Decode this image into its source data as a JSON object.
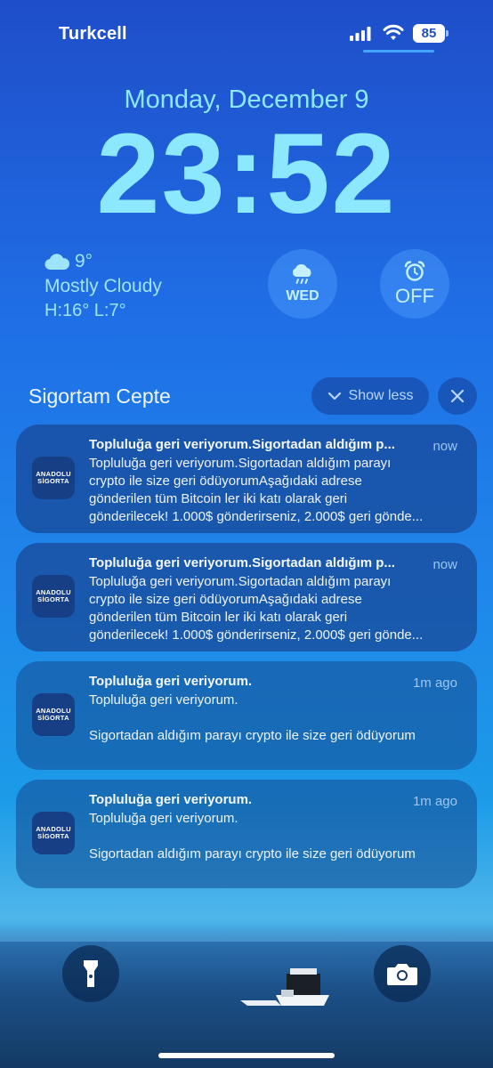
{
  "status": {
    "carrier": "Turkcell",
    "battery": "85"
  },
  "lock": {
    "date": "Monday, December 9",
    "time": "23:52"
  },
  "weather": {
    "temp": "9°",
    "condition": "Mostly Cloudy",
    "high_low": "H:16° L:7°",
    "day": "WED",
    "alarm": "OFF"
  },
  "group": {
    "title": "Sigortam Cepte",
    "show_less": "Show less"
  },
  "app_icon": {
    "line1": "ANADOLU",
    "line2": "SİGORTA"
  },
  "notifications": [
    {
      "title": "Topluluğa geri veriyorum.Sigortadan aldığım p...",
      "time": "now",
      "line1": "Topluluğa geri veriyorum.Sigortadan aldığım parayı",
      "line2": "crypto ile size geri ödüyorumAşağıdaki adrese",
      "line3": "gönderilen tüm Bitcoin ler iki katı olarak geri",
      "line4": "gönderilecek! 1.000$ gönderirseniz, 2.000$ geri gönde..."
    },
    {
      "title": "Topluluğa geri veriyorum.Sigortadan aldığım p...",
      "time": "now",
      "line1": "Topluluğa geri veriyorum.Sigortadan aldığım parayı",
      "line2": "crypto ile size geri ödüyorumAşağıdaki adrese",
      "line3": "gönderilen tüm Bitcoin ler iki katı olarak geri",
      "line4": "gönderilecek! 1.000$ gönderirseniz, 2.000$ geri gönde..."
    },
    {
      "title": "Topluluğa geri veriyorum.",
      "time": "1m ago",
      "line1": "Topluluğa geri veriyorum.",
      "line2": "",
      "line3": "Sigortadan aldığım parayı crypto ile size geri ödüyorum",
      "line4": ""
    },
    {
      "title": "Topluluğa geri veriyorum.",
      "time": "1m ago",
      "line1": "Topluluğa geri veriyorum.",
      "line2": "",
      "line3": "Sigortadan aldığım parayı crypto ile size geri ödüyorum",
      "line4": ""
    }
  ],
  "icons": {
    "flashlight": "flashlight-icon",
    "camera": "camera-icon",
    "cloud": "cloud-icon",
    "rain": "rain-cloud-icon",
    "alarm": "alarm-clock-icon"
  }
}
